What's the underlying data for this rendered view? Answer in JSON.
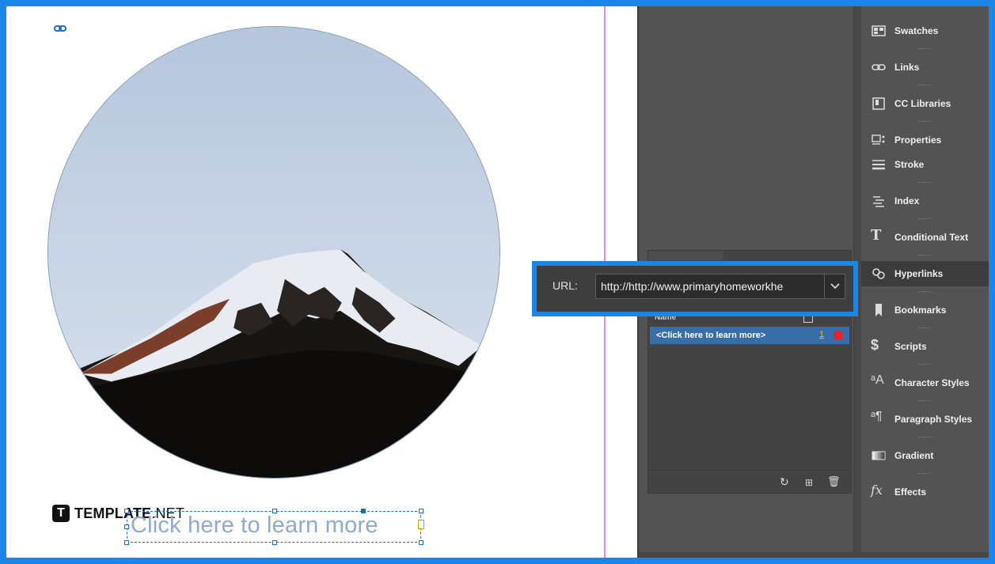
{
  "document": {
    "frame_text": "Click here to learn more",
    "brand": {
      "mark": "T",
      "name_bold": "TEMPLATE",
      "name_light": ".NET"
    }
  },
  "url_bar": {
    "label": "URL:",
    "value": "http://http://www.primaryhomeworkhe"
  },
  "hyperlinks_panel": {
    "column_name": "Name",
    "row": {
      "label": "<Click here to learn more>",
      "count": "1"
    }
  },
  "dock": {
    "items": [
      {
        "label": "Swatches",
        "icon": "swatches-icon"
      },
      {
        "label": "Links",
        "icon": "links-icon"
      },
      {
        "label": "CC Libraries",
        "icon": "cc-libraries-icon"
      },
      {
        "label": "Properties",
        "icon": "properties-icon"
      },
      {
        "label": "Stroke",
        "icon": "stroke-icon"
      },
      {
        "label": "Index",
        "icon": "index-icon"
      },
      {
        "label": "Conditional Text",
        "icon": "conditional-text-icon"
      },
      {
        "label": "Hyperlinks",
        "icon": "hyperlinks-icon",
        "active": true
      },
      {
        "label": "Bookmarks",
        "icon": "bookmarks-icon"
      },
      {
        "label": "Scripts",
        "icon": "scripts-icon"
      },
      {
        "label": "Character Styles",
        "icon": "character-styles-icon"
      },
      {
        "label": "Paragraph Styles",
        "icon": "paragraph-styles-icon"
      },
      {
        "label": "Gradient",
        "icon": "gradient-icon"
      },
      {
        "label": "Effects",
        "icon": "effects-icon"
      }
    ]
  },
  "colors": {
    "accent": "#1a86e8",
    "selection": "#1a6fc4",
    "row_highlight": "#386ea8",
    "panel_bg": "#535353",
    "status_dot": "#e8222a"
  }
}
